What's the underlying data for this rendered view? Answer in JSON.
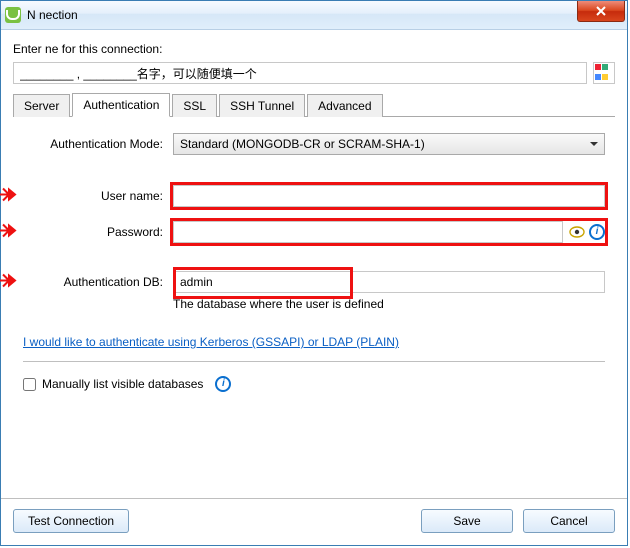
{
  "titlebar": {
    "title": "N          nection"
  },
  "dialog": {
    "prompt": "Enter       ne for this connection:",
    "name_value": "________ , ________名字，可以随便填一个"
  },
  "tabs": [
    {
      "label": "Server",
      "active": false
    },
    {
      "label": "Authentication",
      "active": true
    },
    {
      "label": "SSL",
      "active": false
    },
    {
      "label": "SSH Tunnel",
      "active": false
    },
    {
      "label": "Advanced",
      "active": false
    }
  ],
  "auth": {
    "mode_label": "Authentication Mode:",
    "mode_value": "Standard (MONGODB-CR or SCRAM-SHA-1)",
    "user_label": "User name:",
    "user_value": "",
    "pass_label": "Password:",
    "pass_value": "",
    "db_label": "Authentication DB:",
    "db_value": "admin",
    "db_hint": "The database where the user is defined",
    "kerberos_link": "I would like to authenticate using Kerberos (GSSAPI) or LDAP (PLAIN)",
    "manual_check_label": "Manually list visible databases"
  },
  "footer": {
    "test": "Test Connection",
    "save": "Save",
    "cancel": "Cancel"
  },
  "colors": {
    "highlight": "#e11",
    "link": "#0a5fc4"
  }
}
